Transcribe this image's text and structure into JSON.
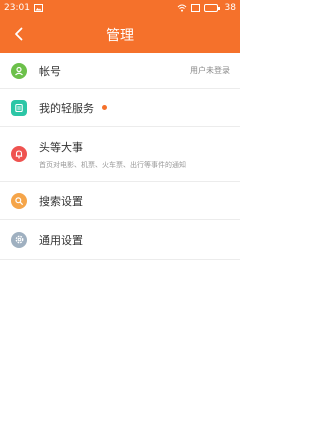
{
  "status": {
    "time": "23:01",
    "battery": "38"
  },
  "appbar": {
    "title": "管理"
  },
  "items": [
    {
      "label": "帐号",
      "right": "用户未登录"
    },
    {
      "label": "我的轻服务"
    },
    {
      "label": "头等大事",
      "sub": "首页对电影、机票、火车票、出行等事件的通知"
    },
    {
      "label": "搜索设置"
    },
    {
      "label": "通用设置"
    }
  ],
  "colors": {
    "accent": "#f5712b",
    "account_icon": "#6cc04a",
    "service_icon": "#2cc6a6",
    "event_icon": "#ef5350",
    "search_icon": "#f5a54a",
    "settings_icon": "#9fb0c0"
  }
}
